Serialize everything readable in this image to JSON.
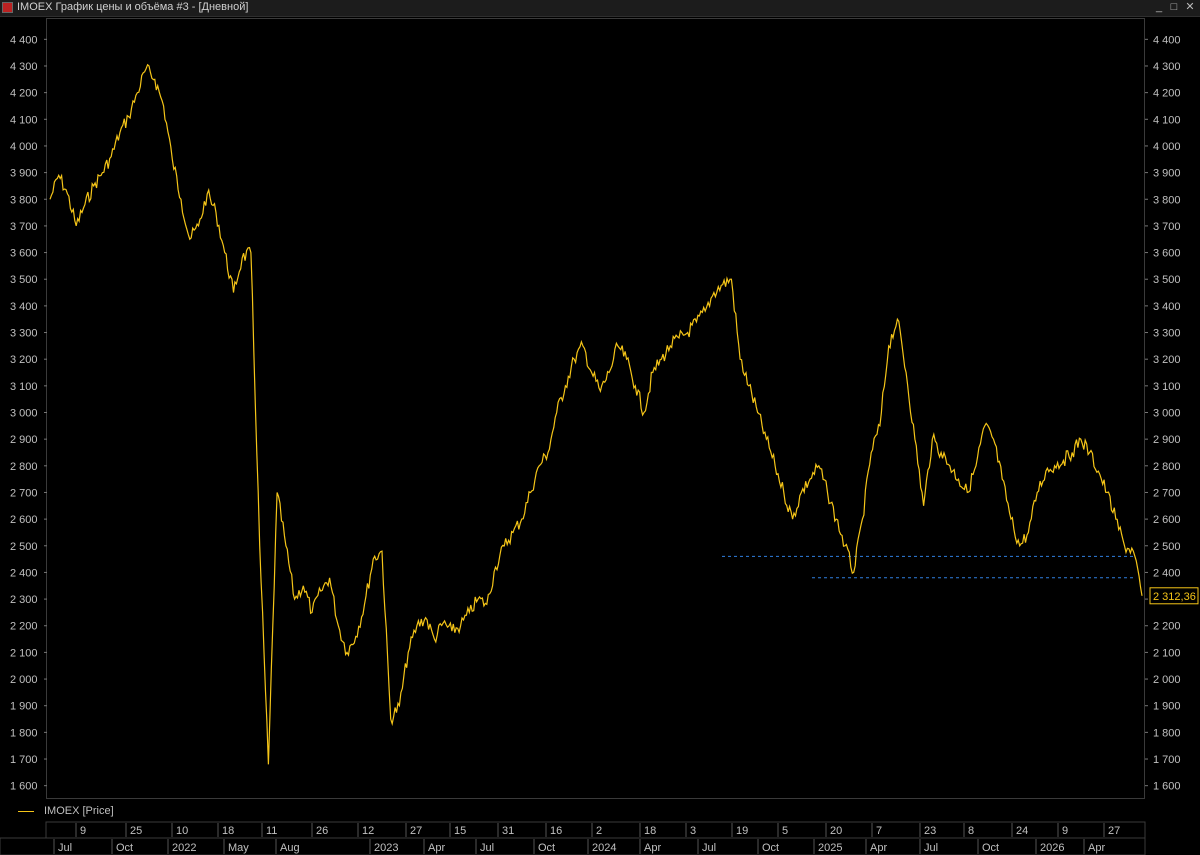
{
  "window": {
    "title": "IMOEX График цены и объёма #3 - [Дневной]",
    "icons": [
      "chart-app-icon",
      "minimize-icon",
      "maximize-icon",
      "close-icon"
    ],
    "minimize_glyph": "_",
    "maximize_glyph": "□",
    "close_glyph": "✕"
  },
  "legend": {
    "label": "IMOEX [Price]"
  },
  "colors": {
    "price_line": "#f5c518",
    "reference_line": "#2f7fe0",
    "grid": "#3a3a3a",
    "background": "#000000"
  },
  "chart_data": {
    "type": "line",
    "title": "",
    "xlabel": "",
    "ylabel": "",
    "ylim": [
      1550,
      4480
    ],
    "y_ticks": [
      "4 400",
      "4 300",
      "4 200",
      "4 100",
      "4 000",
      "3 900",
      "3 800",
      "3 700",
      "3 600",
      "3 500",
      "3 400",
      "3 300",
      "3 200",
      "3 100",
      "3 000",
      "2 900",
      "2 800",
      "2 700",
      "2 600",
      "2 500",
      "2 400",
      "2 300",
      "2 200",
      "2 100",
      "2 000",
      "1 900",
      "1 800",
      "1 700",
      "1 600"
    ],
    "y_tick_values": [
      4400,
      4300,
      4200,
      4100,
      4000,
      3900,
      3800,
      3700,
      3600,
      3500,
      3400,
      3300,
      3200,
      3100,
      3000,
      2900,
      2800,
      2700,
      2600,
      2500,
      2400,
      2300,
      2200,
      2100,
      2000,
      1900,
      1800,
      1700,
      1600
    ],
    "x_top_ticks": [
      "9",
      "25",
      "10",
      "18",
      "11",
      "26",
      "12",
      "27",
      "15",
      "31",
      "16",
      "2",
      "18",
      "3",
      "19",
      "5",
      "20",
      "7",
      "23",
      "8",
      "24",
      "9",
      "27"
    ],
    "x_bottom_ticks": [
      "Jul",
      "Oct",
      "2022",
      "May",
      "Aug",
      "2023",
      "Apr",
      "Jul",
      "Oct",
      "2024",
      "Apr",
      "Jul",
      "Oct",
      "2025",
      "Apr",
      "Jul",
      "Oct",
      "2026",
      "Apr"
    ],
    "last_value_label": "2 312,36",
    "last_value": 2312.36,
    "reference_lines": [
      {
        "y": 2460,
        "x_start_index": 14
      },
      {
        "y": 2380,
        "x_start_index": 11
      }
    ],
    "series": [
      {
        "values": [
          3800,
          3890,
          3820,
          3700,
          3780,
          3850,
          3900,
          3960,
          4050,
          4110,
          4200,
          4290,
          4250,
          4150,
          3950,
          3800,
          3650,
          3700,
          3820,
          3750,
          3600,
          3450,
          3580,
          3600,
          2500,
          1680,
          2700,
          2500,
          2300,
          2350,
          2250,
          2330,
          2380,
          2200,
          2100,
          2160,
          2280,
          2450,
          2480,
          1850,
          1900,
          2100,
          2200,
          2230,
          2150,
          2210,
          2180,
          2200,
          2250,
          2300,
          2280,
          2420,
          2500,
          2550,
          2600,
          2700,
          2800,
          2850,
          3000,
          3100,
          3200,
          3250,
          3150,
          3080,
          3150,
          3250,
          3200,
          3100,
          3000,
          3150,
          3200,
          3250,
          3280,
          3300,
          3340,
          3380,
          3450,
          3480,
          3500,
          3200,
          3100,
          3000,
          2900,
          2800,
          2700,
          2600,
          2700,
          2750,
          2800,
          2700,
          2600,
          2500,
          2400,
          2600,
          2850,
          2950,
          3250,
          3350,
          3150,
          2900,
          2650,
          2900,
          2850,
          2800,
          2750,
          2700,
          2800,
          2950,
          2900,
          2750,
          2600,
          2500,
          2550,
          2700,
          2780,
          2800,
          2820,
          2850,
          2900,
          2850,
          2780,
          2700,
          2600,
          2500,
          2480,
          2312.36
        ]
      }
    ]
  }
}
